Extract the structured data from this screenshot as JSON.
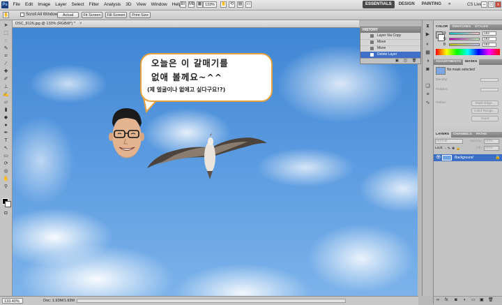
{
  "menubar": {
    "logo": "Ps",
    "menus": [
      "File",
      "Edit",
      "Image",
      "Layer",
      "Select",
      "Filter",
      "Analysis",
      "3D",
      "View",
      "Window",
      "Help"
    ],
    "zoom": "133%",
    "workspaces": [
      "ESSENTIALS",
      "DESIGN",
      "PAINTING",
      "»"
    ],
    "cs_live": "CS Live",
    "window_controls": [
      "–",
      "□",
      "x"
    ]
  },
  "options": {
    "scroll_all_label": "Scroll All Windows",
    "buttons": [
      "Actual Pixels",
      "Fit Screen",
      "Fill Screen",
      "Print Size"
    ]
  },
  "document": {
    "tab_title": "DSC_8126.jpg @ 133% (RGB/8*) *",
    "close": "×",
    "bubble": {
      "line1": "오늘은 이 갈매기를",
      "line2": "없애 볼께요~^^",
      "line3": "(제 얼굴이나 없애고 싶다구요!?)"
    },
    "colors": {
      "bubble_border": "#e9a23b",
      "sky_top": "#3f86d4",
      "sky_bottom": "#7cb3ea"
    }
  },
  "status": {
    "zoom": "133.40%",
    "doc": "Doc: 1.93M/1.93M"
  },
  "history": {
    "title": "HISTORY",
    "items": [
      "Layer Via Copy",
      "Move",
      "Move",
      "Delete Layer"
    ],
    "selected_index": 3
  },
  "color_panel": {
    "tabs": [
      "COLOR",
      "SWATCHES",
      "STYLES"
    ],
    "channels": [
      {
        "label": "R",
        "value": "192"
      },
      {
        "label": "G",
        "value": "192"
      },
      {
        "label": "B",
        "value": "192"
      }
    ]
  },
  "adjust_panel": {
    "tabs": [
      "ADJUSTMENTS",
      "MASKS"
    ],
    "mask_text": "No mask selected",
    "fields": [
      "Density:",
      "Feather:"
    ],
    "refine_label": "Refine:",
    "buttons": [
      "Mask Edge...",
      "Color Range...",
      "Invert"
    ]
  },
  "layers_panel": {
    "tabs": [
      "LAYERS",
      "CHANNELS",
      "PATHS"
    ],
    "blend_mode": "Normal",
    "opacity_label": "Opacity:",
    "opacity_value": "100%",
    "lock_label": "Lock:",
    "fill_label": "Fill:",
    "fill_value": "100%",
    "layer_name": "Background"
  }
}
